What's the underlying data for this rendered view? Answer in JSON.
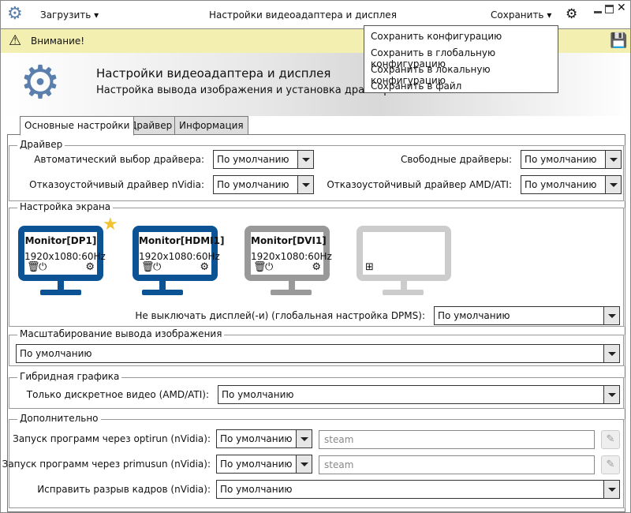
{
  "window": {
    "title": "Настройки видеоадаптера и дисплея",
    "load_label": "Загрузить",
    "save_label": "Сохранить"
  },
  "save_menu": [
    "Сохранить конфигурацию",
    "Сохранить в глобальную конфигурацию",
    "Сохранить в локальную конфигурацию",
    "Сохранить в файл"
  ],
  "warning": "Внимание!",
  "banner": {
    "title": "Настройки видеоадаптера и дисплея",
    "subtitle": "Настройка вывода изображения и установка драйверов"
  },
  "tabs": [
    "Основные настройки",
    "Драйвер",
    "Информация"
  ],
  "driver": {
    "title": "Драйвер",
    "auto_label": "Автоматический выбор драйвера:",
    "auto_value": "По умолчанию",
    "free_label": "Свободные драйверы:",
    "free_value": "По умолчанию",
    "nvidia_label": "Отказоустойчивый драйвер nVidia:",
    "nvidia_value": "По умолчанию",
    "amd_label": "Отказоустойчивый драйвер AMD/ATI:",
    "amd_value": "По умолчанию"
  },
  "screen": {
    "title": "Настройка экрана",
    "monitors": [
      {
        "name": "Monitor[DP1]",
        "mode": "1920x1080:60Hz"
      },
      {
        "name": "Monitor[HDMI1]",
        "mode": "1920x1080:60Hz"
      },
      {
        "name": "Monitor[DVI1]",
        "mode": "1920x1080:60Hz"
      }
    ],
    "dpms_label": "Не выключать дисплей(-и) (глобальная настройка DPMS):",
    "dpms_value": "По умолчанию"
  },
  "scaling": {
    "title": "Масштабирование вывода изображения",
    "value": "По умолчанию"
  },
  "hybrid": {
    "title": "Гибридная графика",
    "label": "Только дискретное видео (AMD/ATI):",
    "value": "По умолчанию"
  },
  "extra": {
    "title": "Дополнительно",
    "optirun_label": "Запуск программ через optirun (nVidia):",
    "optirun_value": "По умолчанию",
    "optirun_placeholder": "steam",
    "primusun_label": "Запуск программ через primusun (nVidia):",
    "primusun_value": "По умолчанию",
    "primusun_placeholder": "steam",
    "tearing_label": "Исправить разрыв кадров (nVidia):",
    "tearing_value": "По умолчанию"
  },
  "colors": {
    "accent": "#0b5394",
    "warning_bg": "#f2efb0",
    "icon_blue": "#5b7fad"
  }
}
